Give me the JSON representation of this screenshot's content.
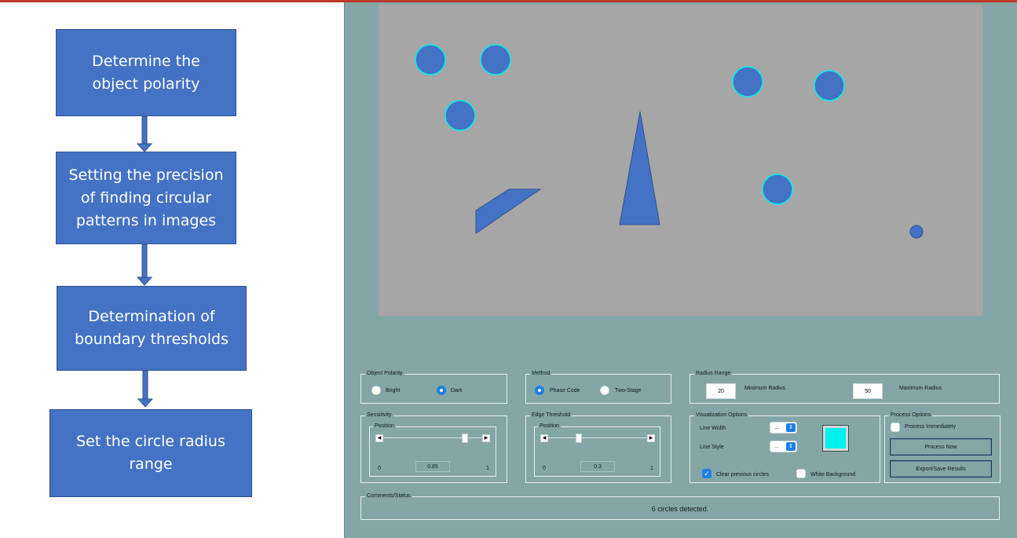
{
  "flowchart": {
    "steps": [
      "Determine the object polarity",
      "Setting the precision of finding circular patterns in images",
      "Determination of boundary thresholds",
      "Set the circle radius range"
    ]
  },
  "app": {
    "object_polarity": {
      "title": "Object Polarity",
      "options": [
        "Bright",
        "Dark"
      ],
      "selected": "Dark"
    },
    "method": {
      "title": "Method",
      "options": [
        "Phase Code",
        "Two-Stage"
      ],
      "selected": "Phase Code"
    },
    "radius_range": {
      "title": "Radius Range",
      "min_value": "20",
      "min_label": "Minimum Radius",
      "max_value": "50",
      "max_label": "Maximum Radius"
    },
    "sensitivity": {
      "title": "Sensitivity",
      "position_label": "Position",
      "min": "0",
      "max": "1",
      "value": "0.85",
      "fraction": 0.85
    },
    "edge_threshold": {
      "title": "Edge Threshold",
      "position_label": "Position",
      "min": "0",
      "max": "1",
      "value": "0.3",
      "fraction": 0.3
    },
    "visualization": {
      "title": "Visualization Options",
      "line_width_label": "Line Width",
      "line_width_value": "...",
      "line_style_label": "Line Style",
      "line_style_value": "...",
      "color": "#00f0f0",
      "clear_previous_label": "Clear previous circles",
      "clear_previous_checked": true,
      "white_background_label": "White Background",
      "white_background_checked": false
    },
    "process": {
      "title": "Process Options",
      "process_immediately_label": "Process Immediately",
      "process_immediately_checked": false,
      "process_now_label": "Process Now",
      "export_label": "Export/Save Results"
    },
    "comments": {
      "title": "Comments/Status",
      "status_text": "6 circles detected."
    },
    "colors": {
      "app_background": "#85a6a6",
      "canvas_background": "#a6a6a6",
      "shape_fill": "#4472c4",
      "circle_outline": "#00f0f0",
      "accent": "#1d7fe6"
    }
  }
}
